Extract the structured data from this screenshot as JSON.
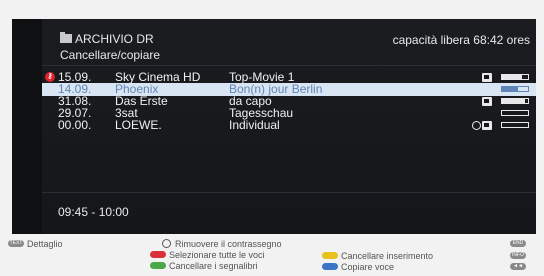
{
  "header": {
    "archive_title": "ARCHIVIO DR",
    "subtitle": "Cancellare/copiare",
    "free_space": "capacità libera 68:42 ores"
  },
  "rows": [
    {
      "date": "15.09.",
      "channel": "Sky Cinema HD",
      "title": "Top-Movie 1",
      "selected": false,
      "locked": true,
      "progress": 0.75
    },
    {
      "date": "14.09.",
      "channel": "Phoenix",
      "title": "Bon(n) jour Berlin",
      "selected": true,
      "locked": false,
      "progress": 0.6
    },
    {
      "date": "31.08.",
      "channel": "Das Erste",
      "title": "da capo",
      "selected": false,
      "locked": false,
      "progress": 0.9
    },
    {
      "date": "29.07.",
      "channel": "3sat",
      "title": "Tagesschau",
      "selected": false,
      "locked": false,
      "progress": 0.0
    },
    {
      "date": "00.00.",
      "channel": "LOEWE.",
      "title": "Individual",
      "selected": false,
      "locked": false,
      "progress": 0.0
    }
  ],
  "time_range": "09:45 - 10:00",
  "legend": {
    "text_key": "TEXT",
    "detail": "Dettaglio",
    "remove_mark": "Rimuovere il contrassegno",
    "select_all": "Selezionare tutte le voci",
    "delete_bookmarks": "Cancellare i segnalibri",
    "delete_entry": "Cancellare inserimento",
    "copy_entry": "Copiare voce",
    "end_key": "END",
    "info_key": "INFO",
    "back_key": "◄◄"
  }
}
